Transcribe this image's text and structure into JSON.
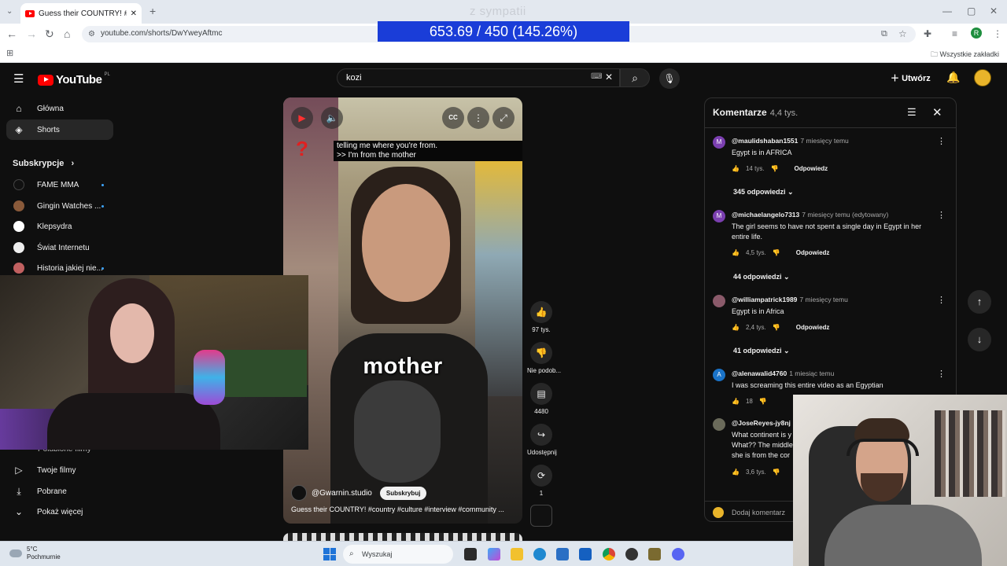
{
  "browser": {
    "tab_title": "Guess their COUNTRY! #country",
    "url": "youtube.com/shorts/DwYweyAftmc",
    "bookmarks_all": "Wszystkie zakładki",
    "profile_letter": "R"
  },
  "overlay": {
    "top_text": "z sympatii",
    "counter": "653.69 / 450 (145.26%)"
  },
  "youtube": {
    "logo_text": "YouTube",
    "logo_region": "PL",
    "search_value": "kozi",
    "create_label": "Utwórz",
    "sidebar": {
      "home": "Główna",
      "shorts": "Shorts",
      "subscriptions_heading": "Subskrypcje",
      "subs": [
        "FAME MMA",
        "Gingin Watches ...",
        "Klepsydra",
        "Świat Internetu",
        "Historia jakiej nie..."
      ],
      "liked": "Polubione filmy",
      "your_videos": "Twoje filmy",
      "downloads": "Pobrane",
      "show_more": "Pokaż więcej"
    },
    "video": {
      "caption_line1": "telling me where you're from.",
      "caption_line2": ">> I'm from the mother",
      "big_word": "mother",
      "channel": "@Gwarnin.studio",
      "subscribe": "Subskrybuj",
      "title": "Guess their COUNTRY! #country #culture #interview #community ...",
      "cc": "CC"
    },
    "actions": {
      "likes": "97 tys.",
      "dislike": "Nie podob...",
      "comments": "4480",
      "share": "Udostępnij",
      "remix": "1"
    },
    "comments": {
      "heading": "Komentarze",
      "count": "4,4 tys.",
      "add_placeholder": "Dodaj komentarz",
      "reply_label": "Odpowiedz",
      "items": [
        {
          "initial": "M",
          "user": "@maulidshaban1551",
          "time": "7 miesięcy temu",
          "text": "Egypt is in AFRICA",
          "likes": "14 tys.",
          "replies": "345 odpowiedzi",
          "color": "#7b3fb0"
        },
        {
          "initial": "M",
          "user": "@michaelangelo7313",
          "time": "7 miesięcy temu (edytowany)",
          "text": "The girl seems to have not spent a single day in Egypt in her entire life.",
          "likes": "4,5 tys.",
          "replies": "44 odpowiedzi",
          "color": "#7b3fb0"
        },
        {
          "initial": "",
          "user": "@williampatrick1989",
          "time": "7 miesięcy temu",
          "text": "Egypt is in Africa",
          "likes": "2,4 tys.",
          "replies": "41 odpowiedzi",
          "color": "#8a5a6a"
        },
        {
          "initial": "A",
          "user": "@alenawalid4760",
          "time": "1 miesiąc temu",
          "text": "I was screaming this entire video as an Egyptian",
          "likes": "18",
          "replies": "",
          "color": "#1a73c8"
        },
        {
          "initial": "",
          "user": "@JoseReyes-jy8nj",
          "time": "7",
          "text": "What continent is y\nWhat?? The middle\nshe is from the cor",
          "likes": "3,6 tys.",
          "replies": "",
          "color": "#6a6a5a"
        }
      ]
    }
  },
  "taskbar": {
    "temperature": "5°C",
    "weather": "Pochmurnie",
    "search": "Wyszukaj"
  }
}
